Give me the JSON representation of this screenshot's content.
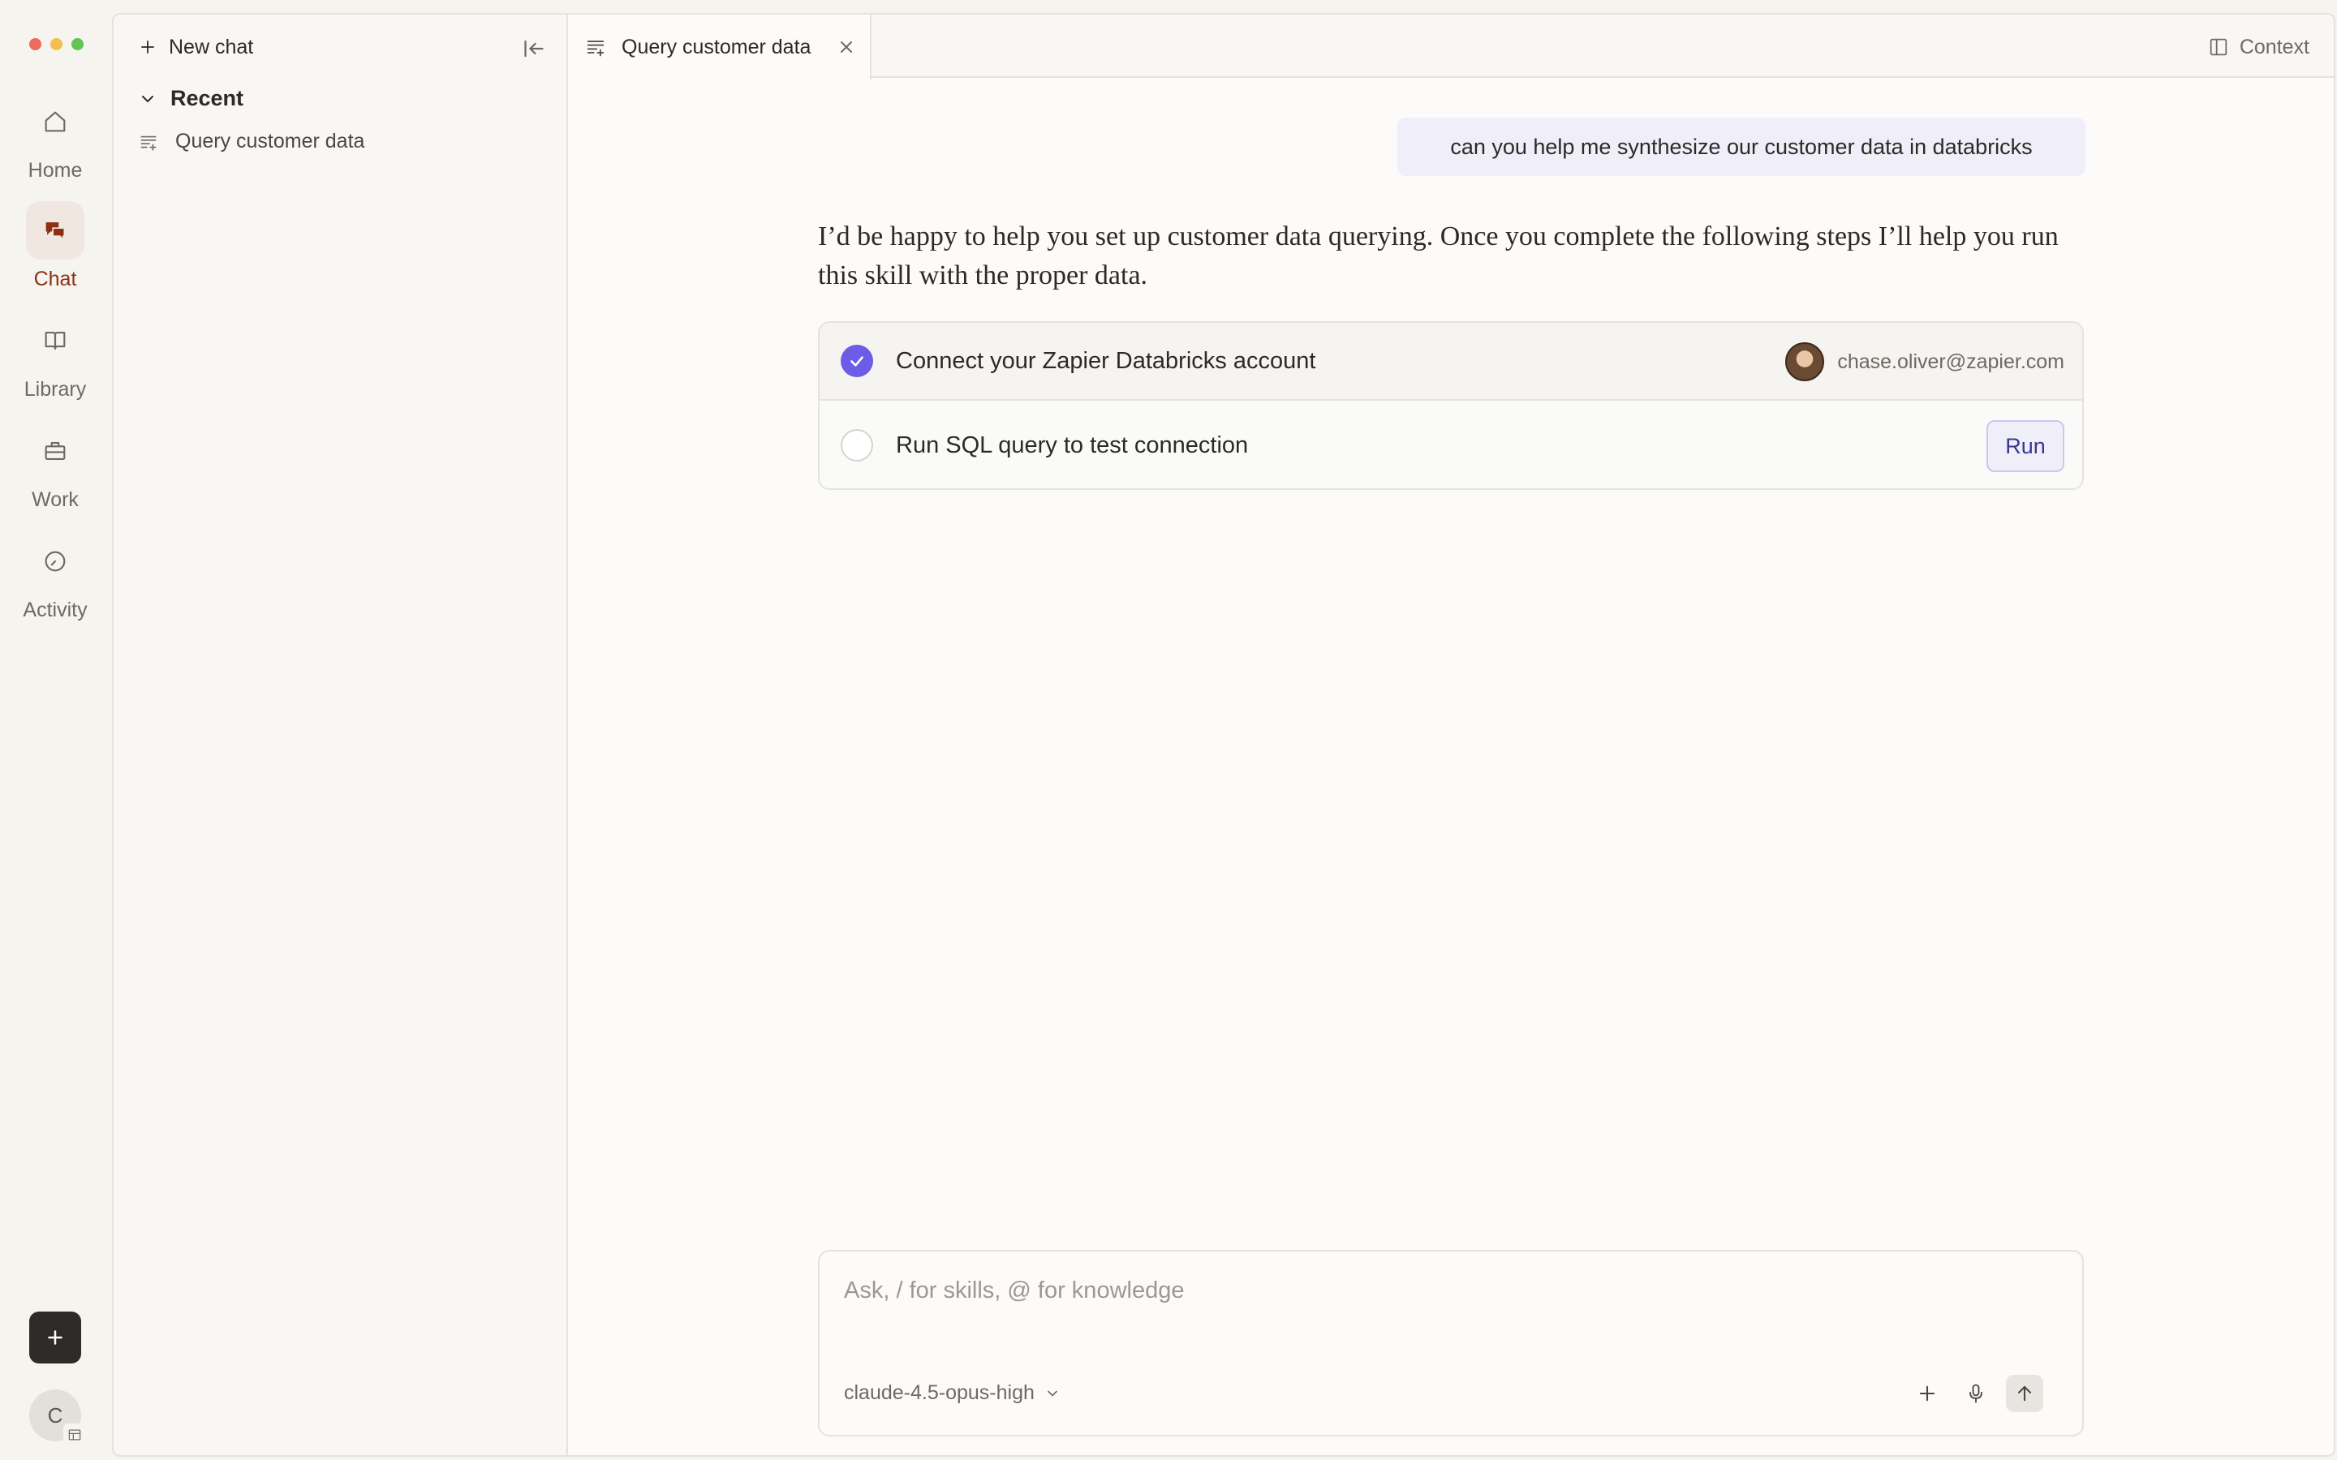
{
  "window": {
    "traffic_lights": [
      "#ec6a5e",
      "#f4bf4f",
      "#61c554"
    ]
  },
  "rail": {
    "items": [
      {
        "label": "Home",
        "icon": "home-icon"
      },
      {
        "label": "Chat",
        "icon": "chat-icon",
        "active": true
      },
      {
        "label": "Library",
        "icon": "book-icon"
      },
      {
        "label": "Work",
        "icon": "briefcase-icon"
      },
      {
        "label": "Activity",
        "icon": "clock-icon"
      }
    ],
    "new_button_icon": "plus-icon",
    "user_avatar_initial": "C"
  },
  "sidebar": {
    "new_chat_label": "New chat",
    "recent_header": "Recent",
    "recent_items": [
      {
        "label": "Query customer data",
        "icon": "chat-list-icon"
      }
    ]
  },
  "tabs": [
    {
      "label": "Query customer data",
      "icon": "chat-list-icon",
      "active": true
    }
  ],
  "header": {
    "context_label": "Context"
  },
  "chat": {
    "user_message": "can you help me synthesize our customer data in databricks",
    "assistant_message": "I’d be happy to help you set up customer data querying. Once you complete the following steps I’ll help you run this skill with the proper data.",
    "steps": [
      {
        "label": "Connect your Zapier Databricks account",
        "done": true,
        "account": "chase.oliver@zapier.com"
      },
      {
        "label": "Run SQL query to test connection",
        "done": false,
        "action_label": "Run"
      }
    ]
  },
  "composer": {
    "placeholder": "Ask, / for skills, @ for knowledge",
    "model": "claude-4.5-opus-high"
  },
  "colors": {
    "accent_active": "#8e2f14",
    "check_purple": "#6c5ce7",
    "run_text": "#3b3791"
  }
}
